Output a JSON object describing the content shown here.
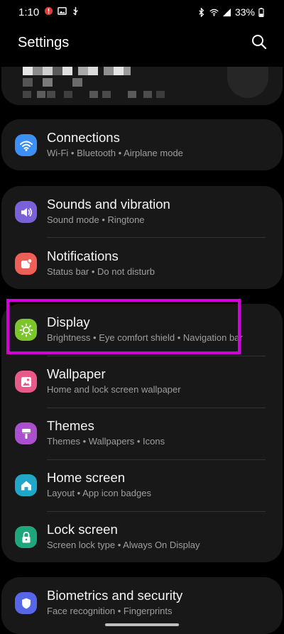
{
  "status_bar": {
    "time": "1:10",
    "battery": "33%"
  },
  "header": {
    "title": "Settings"
  },
  "groups": [
    {
      "items": [
        {
          "label": "Connections",
          "sub": "Wi-Fi  •  Bluetooth  •  Airplane mode",
          "icon": "wifi-icon",
          "color": "#3b8ff5"
        }
      ]
    },
    {
      "items": [
        {
          "label": "Sounds and vibration",
          "sub": "Sound mode  •  Ringtone",
          "icon": "volume-icon",
          "color": "#7b61d9"
        },
        {
          "label": "Notifications",
          "sub": "Status bar  •  Do not disturb",
          "icon": "notification-icon",
          "color": "#ee5f55"
        }
      ]
    },
    {
      "items": [
        {
          "label": "Display",
          "sub": "Brightness  •  Eye comfort shield  •  Navigation bar",
          "icon": "sun-icon",
          "color": "#7cc52d"
        },
        {
          "label": "Wallpaper",
          "sub": "Home and lock screen wallpaper",
          "icon": "image-icon",
          "color": "#e75b88"
        },
        {
          "label": "Themes",
          "sub": "Themes  •  Wallpapers  •  Icons",
          "icon": "brush-icon",
          "color": "#a94fcf"
        },
        {
          "label": "Home screen",
          "sub": "Layout  •  App icon badges",
          "icon": "home-icon",
          "color": "#20a6c9"
        },
        {
          "label": "Lock screen",
          "sub": "Screen lock type  •  Always On Display",
          "icon": "lock-icon",
          "color": "#1ea77c"
        }
      ]
    },
    {
      "items": [
        {
          "label": "Biometrics and security",
          "sub": "Face recognition  •  Fingerprints",
          "icon": "shield-icon",
          "color": "#5566e6"
        }
      ]
    }
  ],
  "highlight_color": "#d300d9"
}
